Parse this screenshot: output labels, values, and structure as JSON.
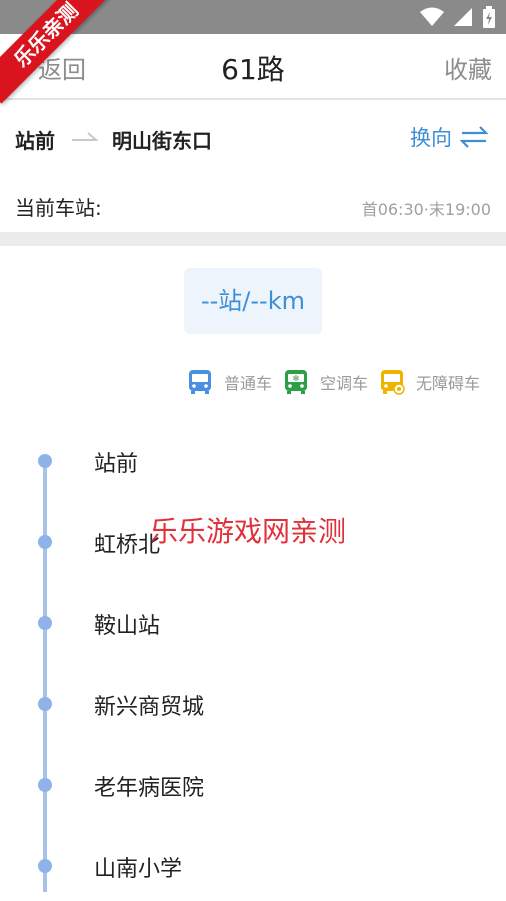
{
  "status_bar": {
    "icons": [
      "wifi-icon",
      "signal-icon",
      "battery-icon"
    ]
  },
  "ribbon": {
    "text": "乐乐亲测"
  },
  "header": {
    "back_label": "返回",
    "title": "61路",
    "favorite_label": "收藏"
  },
  "route": {
    "from": "站前",
    "to": "明山街东口",
    "switch_label": "换向"
  },
  "current": {
    "label": "当前车站:",
    "time_info": "首06:30·末19:00"
  },
  "distance": {
    "text": "--站/--km"
  },
  "legend": [
    {
      "label": "普通车",
      "color": "#4a90e2",
      "icon": "bus-icon"
    },
    {
      "label": "空调车",
      "color": "#2e9e48",
      "icon": "ac-bus-icon"
    },
    {
      "label": "无障碍车",
      "color": "#f0b400",
      "icon": "accessible-bus-icon"
    }
  ],
  "stops": [
    "站前",
    "虹桥北",
    "鞍山站",
    "新兴商贸城",
    "老年病医院",
    "山南小学"
  ],
  "watermark": "乐乐游戏网亲测",
  "colors": {
    "accent": "#3d8fd8",
    "timeline": "#a8c3eb",
    "ribbon": "#d9141e"
  }
}
